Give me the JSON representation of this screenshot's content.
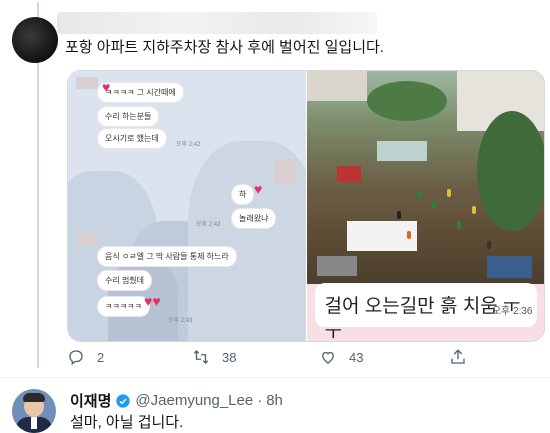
{
  "tweet": {
    "text": "포항 아파트 지하주차장 참사 후에 벌어진 일입니다.",
    "actions": {
      "replies": "2",
      "retweets": "38",
      "likes": "43"
    }
  },
  "chat": {
    "bubbles": [
      "ㅋㅋㅋㅋ 그 시간때에",
      "수리 하는분들",
      "오시기로 했는데",
      "하",
      "놀래왔냐",
      "음식 ㅇㄹ엘 그 딱 사람들 통제 하느라",
      "수리 멈췄데",
      "ㅋㅋㅋㅋㅋ"
    ],
    "times": [
      "오후 2:42",
      "오후 2:42",
      "오후 2:42",
      "오후 2:43"
    ]
  },
  "photo_caption": {
    "text": "걸어 오는길만 흙 치움 ㅜㅜ",
    "time": "오후 2:36"
  },
  "reply": {
    "name": "이재명",
    "handle": "@Jaemyung_Lee",
    "separator": "·",
    "time": "8h",
    "text": "설마, 아닐 겁니다."
  },
  "colors": {
    "icon_gray": "#536471",
    "verified_blue": "#1d9bf0",
    "divider": "#eff3f4"
  },
  "icons": [
    "reply-icon",
    "retweet-icon",
    "like-icon",
    "share-icon",
    "verified-badge-icon"
  ]
}
